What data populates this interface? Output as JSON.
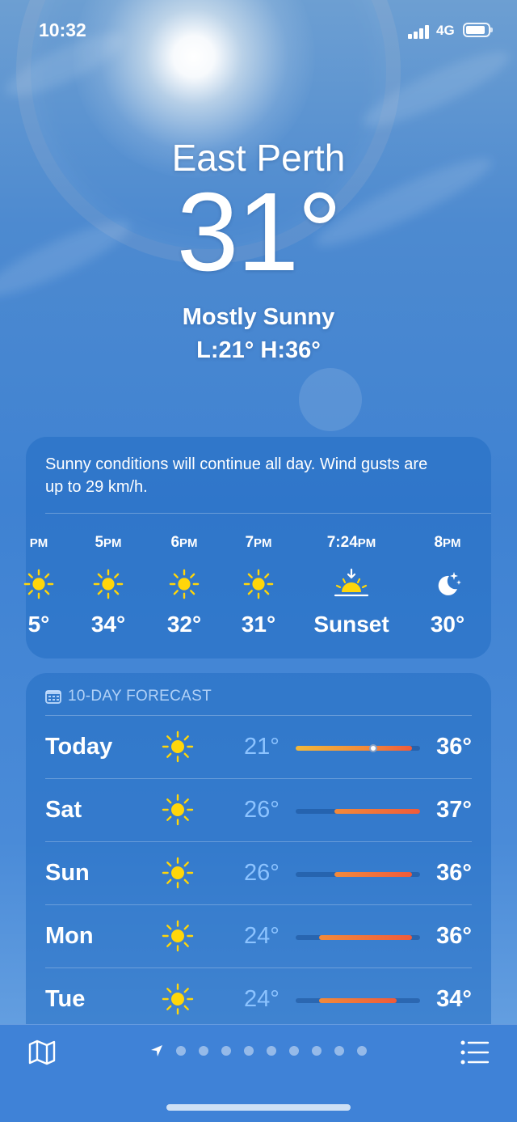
{
  "status_bar": {
    "time": "10:32",
    "network": "4G"
  },
  "location": {
    "name": "East Perth",
    "temperature": "31°",
    "condition": "Mostly Sunny",
    "low_high": "L:21° H:36°"
  },
  "hourly": {
    "summary": "Sunny conditions will continue all day. Wind gusts are up to 29 km/h.",
    "items": [
      {
        "time": "PM",
        "icon": "sun-icon",
        "temp": "5°"
      },
      {
        "time": "5PM",
        "icon": "sun-icon",
        "temp": "34°"
      },
      {
        "time": "6PM",
        "icon": "sun-icon",
        "temp": "32°"
      },
      {
        "time": "7PM",
        "icon": "sun-icon",
        "temp": "31°"
      },
      {
        "time": "7:24PM",
        "icon": "sunset-icon",
        "temp": "Sunset"
      },
      {
        "time": "8PM",
        "icon": "moon-stars-icon",
        "temp": "30°"
      }
    ]
  },
  "daily": {
    "header": "10-DAY FORECAST",
    "range_min": 21,
    "range_max": 37,
    "current_temp": 31,
    "days": [
      {
        "day": "Today",
        "icon": "sun-icon",
        "low": "21°",
        "high": "36°",
        "low_value": 21,
        "high_value": 36
      },
      {
        "day": "Sat",
        "icon": "sun-icon",
        "low": "26°",
        "high": "37°",
        "low_value": 26,
        "high_value": 37
      },
      {
        "day": "Sun",
        "icon": "sun-icon",
        "low": "26°",
        "high": "36°",
        "low_value": 26,
        "high_value": 36
      },
      {
        "day": "Mon",
        "icon": "sun-icon",
        "low": "24°",
        "high": "36°",
        "low_value": 24,
        "high_value": 36
      },
      {
        "day": "Tue",
        "icon": "sun-icon",
        "low": "24°",
        "high": "34°",
        "low_value": 24,
        "high_value": 34
      }
    ]
  },
  "bottom_bar": {
    "page_dots": 9
  },
  "colors": {
    "bar_orange": "#f28a3a",
    "bar_red": "#ef5b3a",
    "bar_yellow": "#f2b83a",
    "sun_yellow": "#ffd60a",
    "low_temp_blue": "#8cc3ff"
  }
}
